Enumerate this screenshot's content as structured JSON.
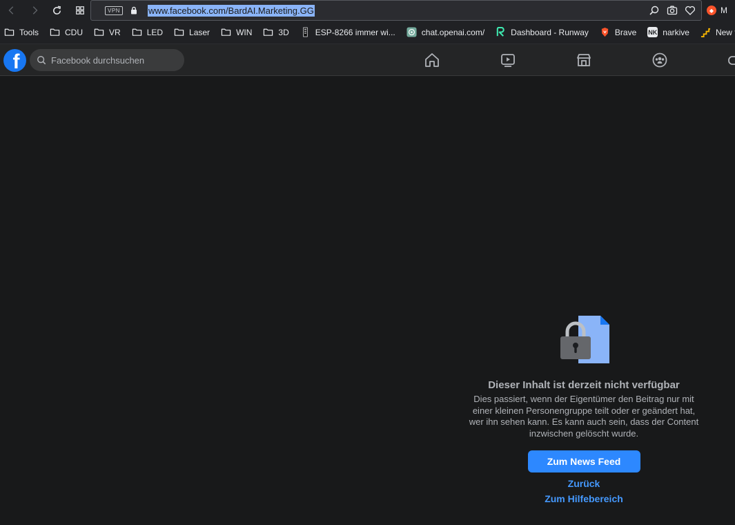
{
  "browser": {
    "url": "www.facebook.com/BardAI.Marketing.GG",
    "vpn_label": "VPN",
    "extension_label": "M",
    "bookmarks": [
      {
        "label": "Tools",
        "icon": "folder-icon"
      },
      {
        "label": "CDU",
        "icon": "folder-icon"
      },
      {
        "label": "VR",
        "icon": "folder-icon"
      },
      {
        "label": "LED",
        "icon": "folder-icon"
      },
      {
        "label": "Laser",
        "icon": "folder-icon"
      },
      {
        "label": "WIN",
        "icon": "folder-icon"
      },
      {
        "label": "3D",
        "icon": "folder-icon"
      },
      {
        "label": "ESP-8266 immer wi...",
        "icon": "esp-board-icon"
      },
      {
        "label": "chat.openai.com/",
        "icon": "openai-icon"
      },
      {
        "label": "Dashboard - Runway",
        "icon": "runway-icon"
      },
      {
        "label": "Brave",
        "icon": "brave-icon"
      },
      {
        "label": "narkive",
        "icon": "nk-icon",
        "icon_text": "NK"
      },
      {
        "label": "New topics -",
        "icon": "stairs-icon"
      }
    ]
  },
  "facebook": {
    "logo_letter": "f",
    "search_placeholder": "Facebook durchsuchen",
    "nav_icons": [
      "home-icon",
      "watch-icon",
      "marketplace-icon",
      "groups-icon",
      "gaming-icon"
    ]
  },
  "content": {
    "title": "Dieser Inhalt ist derzeit nicht verfügbar",
    "body": "Dies passiert, wenn der Eigentümer den Beitrag nur mit einer kleinen Personengruppe teilt oder er geändert hat, wer ihn sehen kann. Es kann auch sein, dass der Content inzwischen gelöscht wurde.",
    "primary_button": "Zum News Feed",
    "back_link": "Zurück",
    "help_link": "Zum Hilfebereich"
  },
  "colors": {
    "fb_blue": "#1877f2",
    "button_blue": "#2d88ff",
    "link_blue": "#4599ff",
    "background": "#18191a",
    "header": "#242526",
    "lock_file": "#8ab4f8"
  }
}
